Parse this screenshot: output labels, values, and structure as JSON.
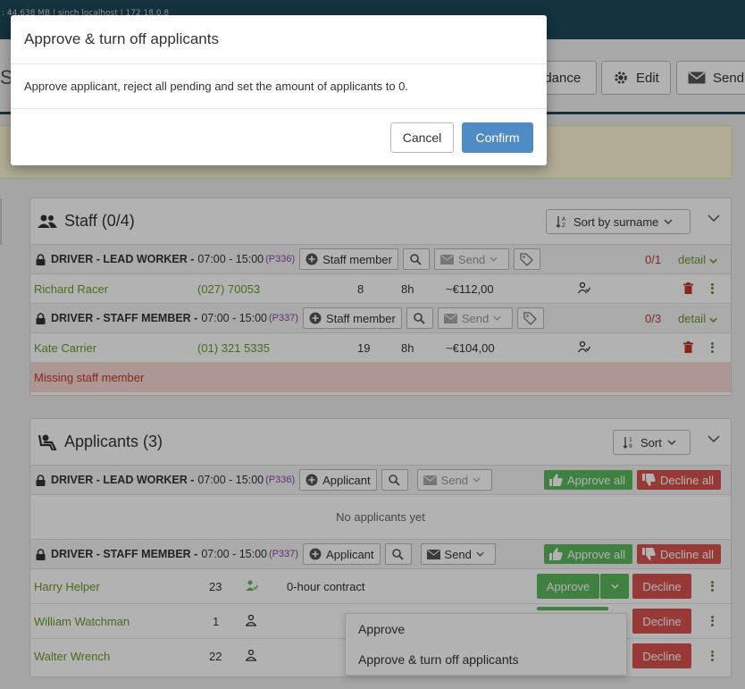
{
  "topbar": {
    "debug_text": ": 44.638 MB | sinch localhost | 172.18.0.8"
  },
  "toolbar": {
    "title_stub": "S",
    "attendance_label": "ndance",
    "edit_label": "Edit",
    "send_label": "Send"
  },
  "staff": {
    "title": "Staff (0/4)",
    "sort_label": "Sort by surname",
    "groups": [
      {
        "role": "DRIVER - LEAD WORKER -",
        "time": "07:00 - 15:00",
        "code": "(P336)",
        "add_label": "Staff member",
        "send_label": "Send",
        "count": "0/1",
        "detail_label": "detail",
        "row": {
          "name": "Richard Racer",
          "phone": "(027) 70053",
          "num": "8",
          "hours": "8h",
          "pay": "~€112,00"
        }
      },
      {
        "role": "DRIVER - STAFF MEMBER -",
        "time": "07:00 - 15:00",
        "code": "(P337)",
        "add_label": "Staff member",
        "send_label": "Send",
        "count": "0/3",
        "detail_label": "detail",
        "row": {
          "name": "Kate Carrier",
          "phone": "(01) 321 5335",
          "num": "19",
          "hours": "8h",
          "pay": "~€104,00"
        }
      }
    ],
    "missing_text": "Missing staff member"
  },
  "applicants": {
    "title": "Applicants (3)",
    "sort_label": "Sort",
    "approve_all_label": "Approve all",
    "decline_all_label": "Decline all",
    "groups": [
      {
        "role": "DRIVER - LEAD WORKER -",
        "time": "07:00 - 15:00",
        "code": "(P336)",
        "add_label": "Applicant",
        "send_label": "Send",
        "empty_text": "No applicants yet"
      },
      {
        "role": "DRIVER - STAFF MEMBER -",
        "time": "07:00 - 15:00",
        "code": "(P337)",
        "add_label": "Applicant",
        "send_label": "Send"
      }
    ],
    "rows": [
      {
        "name": "Harry Helper",
        "num": "23",
        "note": "0-hour contract"
      },
      {
        "name": "William Watchman",
        "num": "1",
        "note": ""
      },
      {
        "name": "Walter Wrench",
        "num": "22",
        "note": ""
      }
    ],
    "approve_label": "Approve",
    "decline_label": "Decline"
  },
  "dropdown": {
    "items": [
      "Approve",
      "Approve & turn off applicants"
    ]
  },
  "modal": {
    "title": "Approve & turn off applicants",
    "body": "Approve applicant, reject all pending and set the amount of applicants to 0.",
    "cancel_label": "Cancel",
    "confirm_label": "Confirm"
  },
  "colors": {
    "accent": "#4f8bc4",
    "green": "#5cb85c",
    "red": "#d9534f",
    "header": "#1d4a5a"
  }
}
